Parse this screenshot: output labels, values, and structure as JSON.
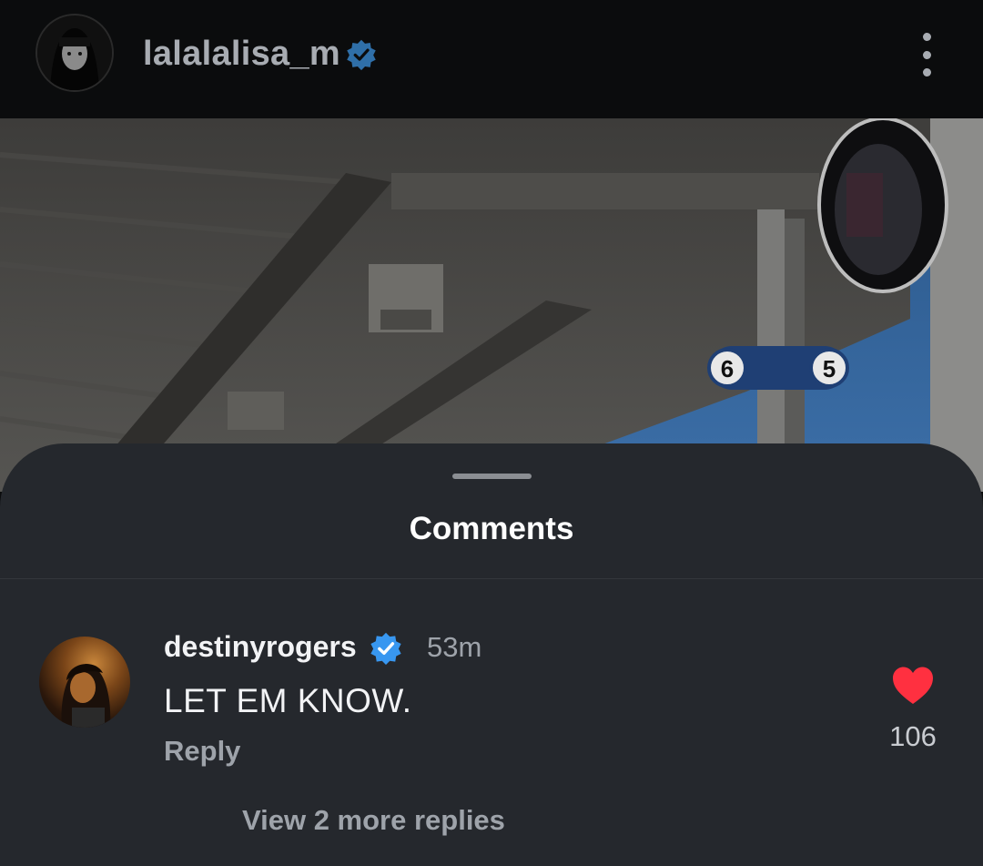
{
  "header": {
    "username": "lalalalisa_m",
    "verified_icon": "verified-badge-icon",
    "menu_icon": "more-vertical-icon"
  },
  "photo": {
    "sign_numbers": [
      "6",
      "5"
    ]
  },
  "comments_sheet": {
    "title": "Comments",
    "comment": {
      "username": "destinyrogers",
      "time": "53m",
      "text": "LET EM KNOW.",
      "reply_label": "Reply",
      "like_count": "106",
      "view_replies_label": "View 2 more replies"
    }
  },
  "colors": {
    "background": "#0b0c0d",
    "sheet": "#25282d",
    "verified_blue": "#3897f0",
    "heart_red": "#ff3040",
    "secondary_text": "#9ea3aa"
  }
}
